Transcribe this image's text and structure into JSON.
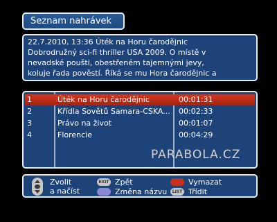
{
  "title": "Seznam nahrávek",
  "info": {
    "lines": [
      "22.7.2010, 13:36 Úték na Horu čarodějnic",
      "Dobrodružný sci-fi thriller USA 2009. O místě v",
      "nevadské poušti, obestřeném tajemnými jevy,",
      "koluje řada pověstí. Říká se mu Hora čarodějnic a"
    ]
  },
  "recordings": [
    {
      "num": "1",
      "title": "Úték na Horu čarodějnic",
      "duration": "00:01:31",
      "selected": true
    },
    {
      "num": "2",
      "title": "Křídla Sovětů Samara-CSKA...",
      "duration": "00:02:33",
      "selected": false
    },
    {
      "num": "3",
      "title": "Právo na život",
      "duration": "00:01:07",
      "selected": false
    },
    {
      "num": "4",
      "title": "Florencie",
      "duration": "00:04:29",
      "selected": false
    }
  ],
  "watermark": "PARABOLA.CZ",
  "help": {
    "select_line1": "Zvolit",
    "select_line2": "a načíst",
    "exit_key": "EXIT",
    "back": "Zpět",
    "delete": "Vymazat",
    "rename": "Změna názvu",
    "list_key": "LIST",
    "sort": "Třídit"
  },
  "colors": {
    "panel": "#1e4378",
    "border": "#e7ecf5",
    "selection": "#c8301a",
    "button_red": "#c8301a",
    "button_purple": "#8d86d4"
  }
}
